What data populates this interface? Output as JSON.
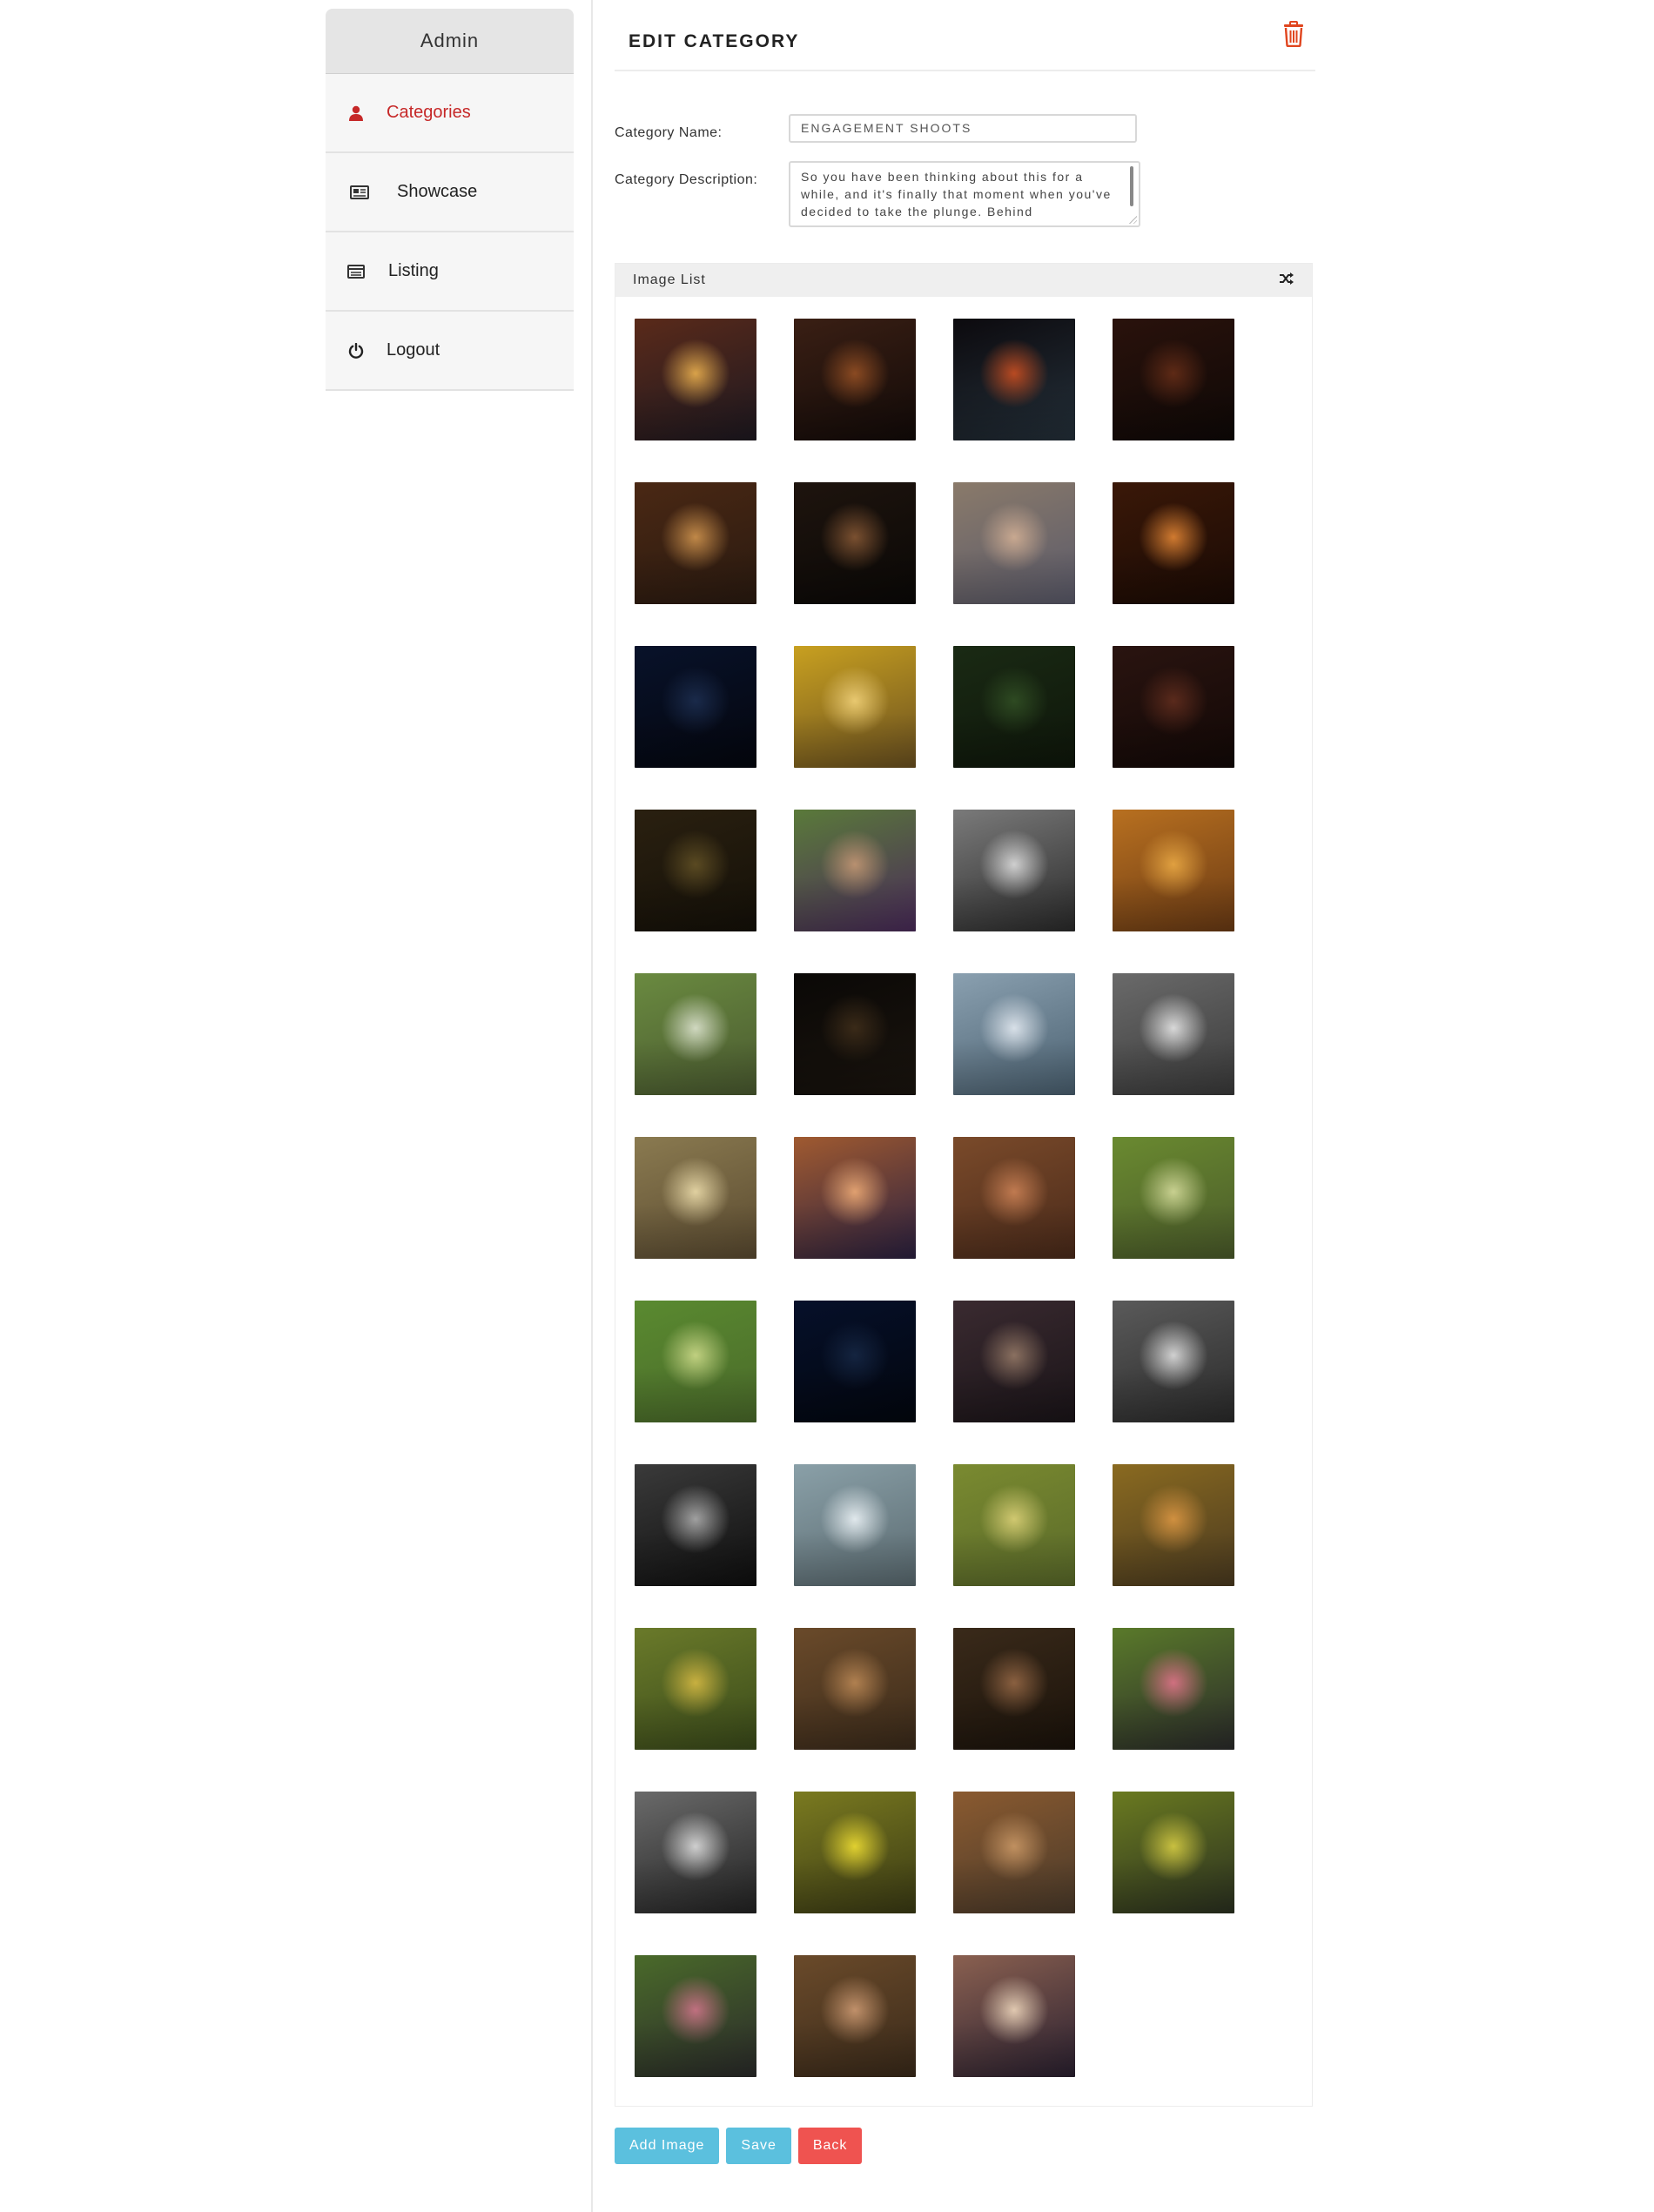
{
  "sidebar": {
    "title": "Admin",
    "items": [
      {
        "label": "Categories",
        "icon": "user-icon",
        "active": true
      },
      {
        "label": "Showcase",
        "icon": "newspaper-icon"
      },
      {
        "label": "Listing",
        "icon": "list-icon"
      },
      {
        "label": "Logout",
        "icon": "power-icon"
      }
    ]
  },
  "main": {
    "title": "EDIT CATEGORY",
    "name_label": "Category Name:",
    "name_value": "ENGAGEMENT SHOOTS",
    "description_label": "Category Description:",
    "description_value": "So you have been thinking about this for a while, and it's finally that moment when you've decided to take the plunge. Behind",
    "image_list_title": "Image List",
    "buttons": {
      "add_image": "Add Image",
      "save": "Save",
      "back": "Back"
    }
  },
  "colors": {
    "accent_red": "#c62828",
    "button_info": "#5bc0de",
    "button_danger": "#ef5350"
  },
  "images": [
    "gazebo at dusk",
    "couple on lit stairway",
    "city night light trails",
    "couple on dark staircase",
    "gothic library hall",
    "blurred lights couple",
    "couple in arcade",
    "couple in orange hallway",
    "couple by night lake",
    "couple embracing in sunlight",
    "green field aerial",
    "couple in dark corridor",
    "couple in forest",
    "couple smiling",
    "couple black and white",
    "couple in autumn trees",
    "couple walking on path",
    "couple at night street",
    "couple sitting on steps",
    "couple black and white portrait",
    "couple walking in park",
    "couple close in autumn",
    "couple under tree",
    "woman posing on path",
    "couple holding hands on path",
    "couple by night water",
    "couple through glass",
    "couple black and white forest",
    "couple close black and white",
    "couple sitting on white steps",
    "couple kissing on path",
    "couple posing in field",
    "man lifting woman",
    "couple on autumn trail",
    "couple with menu board",
    "couple holding chalkboards",
    "couple cheek to cheek bw",
    "couple in yellow shirt",
    "couple in autumn woods",
    "couple hugging in yellow",
    "couple with chalk signs",
    "couple on wooden bridge",
    "couple in cafe"
  ]
}
